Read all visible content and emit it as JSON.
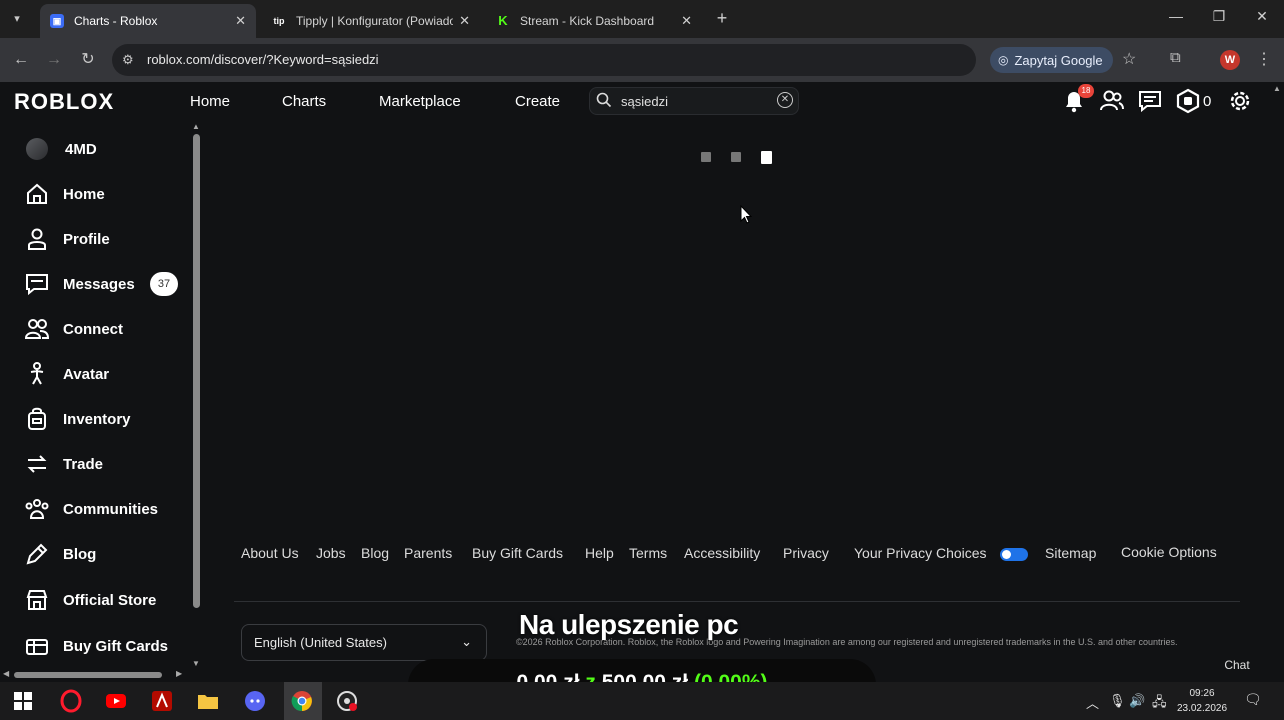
{
  "browser": {
    "tabs": [
      {
        "title": "Charts - Roblox",
        "favicon": "roblox-favicon",
        "active": true
      },
      {
        "title": "Tipply | Konfigurator (Powiadom",
        "favicon": "tipply-favicon",
        "favicon_text": "tip",
        "active": false
      },
      {
        "title": "Stream - Kick Dashboard",
        "favicon": "kick-favicon",
        "favicon_text": "K",
        "active": false
      }
    ],
    "url": "roblox.com/discover/?Keyword=sąsiedzi",
    "google_pill": "Zapytaj Google",
    "profile_initial": "W"
  },
  "header": {
    "logo": "ROBLOX",
    "nav": [
      "Home",
      "Charts",
      "Marketplace",
      "Create"
    ],
    "search_value": "sąsiedzi",
    "notifications_count": "18",
    "robux": "0"
  },
  "sidebar": {
    "items": [
      {
        "label": "4MD",
        "icon": "user-avatar"
      },
      {
        "label": "Home",
        "icon": "home-icon"
      },
      {
        "label": "Profile",
        "icon": "profile-icon"
      },
      {
        "label": "Messages",
        "icon": "messages-icon"
      },
      {
        "label": "Connect",
        "icon": "connect-icon"
      },
      {
        "label": "Avatar",
        "icon": "avatar-icon"
      },
      {
        "label": "Inventory",
        "icon": "inventory-icon"
      },
      {
        "label": "Trade",
        "icon": "trade-icon"
      },
      {
        "label": "Communities",
        "icon": "communities-icon"
      },
      {
        "label": "Blog",
        "icon": "blog-icon"
      },
      {
        "label": "Official Store",
        "icon": "store-icon"
      },
      {
        "label": "Buy Gift Cards",
        "icon": "gift-card-icon"
      }
    ],
    "messages_badge": "37"
  },
  "footer": {
    "links": [
      "About Us",
      "Jobs",
      "Blog",
      "Parents",
      "Buy Gift Cards",
      "Help",
      "Terms",
      "Accessibility",
      "Privacy",
      "Your Privacy Choices",
      "Sitemap",
      "Cookie Options"
    ],
    "language": "English (United States)",
    "copyright": "©2026 Roblox Corporation. Roblox, the Roblox logo and Powering Imagination are among our registered and unregistered trademarks in the U.S. and other countries.",
    "chat": "Chat"
  },
  "overlay": {
    "title": "Na ulepszenie pc",
    "current": "0,00 zł",
    "separator": "z",
    "goal": "500,00 zł",
    "percent": "(0.00%)"
  },
  "taskbar": {
    "time": "09:26",
    "date": "23.02.2026"
  },
  "colors": {
    "background": "#111214",
    "accent_green": "#53fc18",
    "badge_red": "#e8443a",
    "toggle_blue": "#1f73e8"
  }
}
